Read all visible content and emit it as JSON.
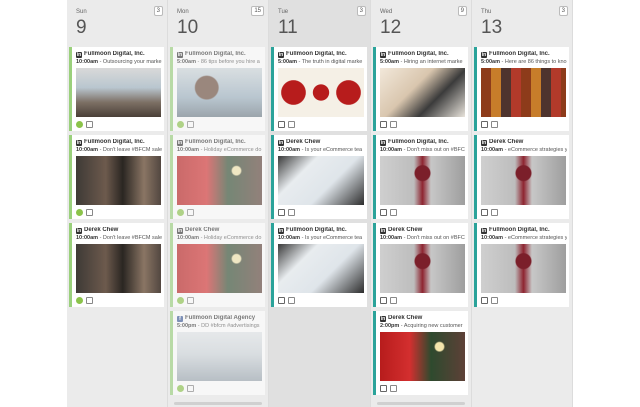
{
  "days": [
    {
      "name": "Sun",
      "num": "9",
      "count": "3",
      "cards": [
        {
          "account": "Fullmoon Digital, Inc.",
          "time": "10:00am",
          "text": "- Outsourcing your marke",
          "image": "meeting-photo",
          "style": "green"
        },
        {
          "account": "Fullmoon Digital, Inc.",
          "time": "10:00am",
          "text": "- Don't leave #BFCM sale",
          "image": "team-photo",
          "style": "green"
        },
        {
          "account": "Derek Chew",
          "time": "10:00am",
          "text": "- Don't leave #BFCM sale",
          "image": "team-photo",
          "style": "green"
        }
      ]
    },
    {
      "name": "Mon",
      "num": "10",
      "count": "15",
      "cards": [
        {
          "account": "Fullmoon Digital, Inc.",
          "time": "5:00am",
          "text": "- 86 tips before you hire a",
          "image": "smiling-man-photo",
          "style": "green dim"
        },
        {
          "account": "Fullmoon Digital, Inc.",
          "time": "10:00am",
          "text": "- Holiday eCommerce do",
          "image": "holiday-gifts-photo",
          "style": "green dim"
        },
        {
          "account": "Derek Chew",
          "time": "10:00am",
          "text": "- Holiday eCommerce do",
          "image": "holiday-gifts-photo",
          "style": "green dim"
        },
        {
          "account": "Fullmoon Digital Agency",
          "time": "5:00pm",
          "text": "- DD #bfcm #advertisings",
          "image": "laptop-dashboard-photo",
          "style": "green dim",
          "facebook": true
        }
      ]
    },
    {
      "name": "Tue",
      "num": "11",
      "count": "3",
      "today": true,
      "cards": [
        {
          "account": "Fullmoon Digital, Inc.",
          "time": "5:00am",
          "text": "- The truth in digital marke",
          "image": "monkeys-illustration",
          "style": ""
        },
        {
          "account": "Derek Chew",
          "time": "10:00am",
          "text": "- Is your eCommerce tea",
          "image": "analytics-laptop-photo",
          "style": ""
        },
        {
          "account": "Fullmoon Digital, Inc.",
          "time": "10:00am",
          "text": "- Is your eCommerce tea",
          "image": "analytics-laptop-photo",
          "style": ""
        }
      ]
    },
    {
      "name": "Wed",
      "num": "12",
      "count": "9",
      "cards": [
        {
          "account": "Fullmoon Digital, Inc.",
          "time": "5:00am",
          "text": "- Hiring an internet marke",
          "image": "woman-laptop-photo",
          "style": ""
        },
        {
          "account": "Fullmoon Digital, Inc.",
          "time": "10:00am",
          "text": "- Don't miss out on #BFC",
          "image": "shopper-photo",
          "style": ""
        },
        {
          "account": "Derek Chew",
          "time": "10:00am",
          "text": "- Don't miss out on #BFC",
          "image": "shopper-photo",
          "style": ""
        },
        {
          "account": "Derek Chew",
          "time": "2:00pm",
          "text": "- Acquiring new customer",
          "image": "holiday-gifts-photo",
          "style": ""
        }
      ]
    },
    {
      "name": "Thu",
      "num": "13",
      "count": "3",
      "cards": [
        {
          "account": "Fullmoon Digital, Inc.",
          "time": "5:00am",
          "text": "- Here are 86 things to kno",
          "image": "spices-photo",
          "style": ""
        },
        {
          "account": "Derek Chew",
          "time": "10:00am",
          "text": "- eCommerce strategies y",
          "image": "shopper-photo",
          "style": ""
        },
        {
          "account": "Fullmoon Digital, Inc.",
          "time": "10:00am",
          "text": "- eCommerce strategies y",
          "image": "shopper-photo",
          "style": ""
        }
      ]
    }
  ],
  "colors": {
    "approved": "#8bc34a",
    "scheduled_accent": "#2ba39a",
    "past_accent": "#9ad07c"
  }
}
